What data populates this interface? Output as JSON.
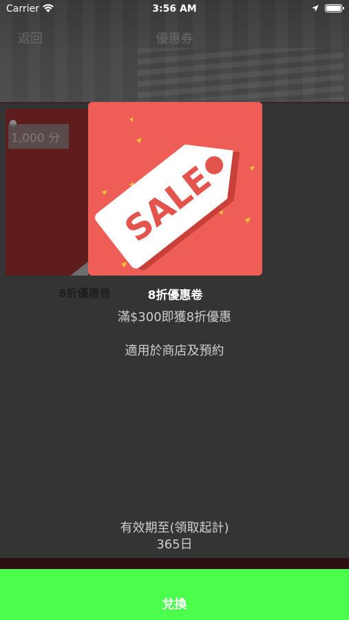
{
  "status_bar": {
    "carrier": "Carrier",
    "time": "3:56 AM"
  },
  "nav": {
    "back_label": "返回",
    "title": "優惠券"
  },
  "background_card": {
    "points": "1,000 分",
    "title": "8折優惠卷",
    "tag_text": "SALE"
  },
  "coupon": {
    "image_text": "SALE",
    "title": "8折優惠卷",
    "description": "滿$300即獲8折優惠",
    "scope": "適用於商店及預約",
    "validity_label": "有效期至(領取起計)",
    "validity_value": "365日"
  },
  "actions": {
    "redeem_label": "兌換"
  },
  "colors": {
    "overlay_bg": "#343434",
    "coupon_red": "#ee5e56",
    "redeem_green": "#4cff4c"
  },
  "icons": [
    "wifi-icon",
    "location-arrow-icon",
    "battery-icon",
    "sale-tag-icon"
  ]
}
